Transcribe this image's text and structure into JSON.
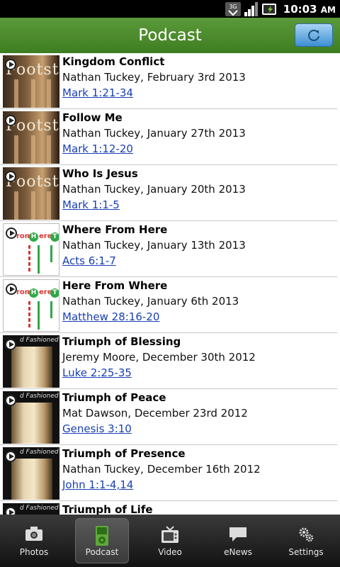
{
  "status": {
    "network": "3G",
    "time": "10:03",
    "ampm": "AM"
  },
  "header": {
    "title": "Podcast",
    "refresh_icon": "refresh-icon"
  },
  "podcasts": [
    {
      "title": "Kingdom Conflict",
      "meta": "Nathan Tuckey, February 3rd 2013",
      "ref": "Mark 1:21-34",
      "thumb": "footsteps",
      "thumb_text": "Footst"
    },
    {
      "title": "Follow Me",
      "meta": "Nathan Tuckey, January 27th 2013",
      "ref": "Mark 1:12-20",
      "thumb": "footsteps",
      "thumb_text": "Footst"
    },
    {
      "title": "Who Is Jesus",
      "meta": "Nathan Tuckey, January 20th 2013",
      "ref": "Mark 1:1-5",
      "thumb": "footsteps",
      "thumb_text": "Footst"
    },
    {
      "title": "Where From Here",
      "meta": "Nathan Tuckey, January 13th 2013",
      "ref": "Acts 6:1-7",
      "thumb": "where-from-here"
    },
    {
      "title": "Here From Where",
      "meta": "Nathan Tuckey, January 6th 2013",
      "ref": "Matthew 28:16-20",
      "thumb": "where-from-here"
    },
    {
      "title": "Triumph of Blessing",
      "meta": "Jeremy Moore, December 30th 2012",
      "ref": "Luke 2:25-35",
      "thumb": "old-fashioned",
      "thumb_text": "d Fashioned"
    },
    {
      "title": "Triumph of Peace",
      "meta": "Mat Dawson, December 23rd 2012",
      "ref": "Genesis 3:10",
      "thumb": "old-fashioned",
      "thumb_text": "d Fashioned"
    },
    {
      "title": "Triumph of Presence",
      "meta": "Nathan Tuckey, December 16th 2012",
      "ref": "John 1:1-4,14",
      "thumb": "old-fashioned",
      "thumb_text": "d Fashioned"
    },
    {
      "title": "Triumph of Life",
      "meta": "",
      "ref": "",
      "thumb": "old-fashioned",
      "thumb_text": "d Fashioned"
    }
  ],
  "tabs": [
    {
      "label": "Photos",
      "icon": "camera-icon",
      "active": false
    },
    {
      "label": "Podcast",
      "icon": "ipod-icon",
      "active": true
    },
    {
      "label": "Video",
      "icon": "tv-icon",
      "active": false
    },
    {
      "label": "eNews",
      "icon": "speech-bubble-icon",
      "active": false
    },
    {
      "label": "Settings",
      "icon": "gears-icon",
      "active": false
    }
  ],
  "colors": {
    "titlebar": "#4a8a2c",
    "link": "#1a3fb5",
    "refresh": "#5aa8e8"
  }
}
